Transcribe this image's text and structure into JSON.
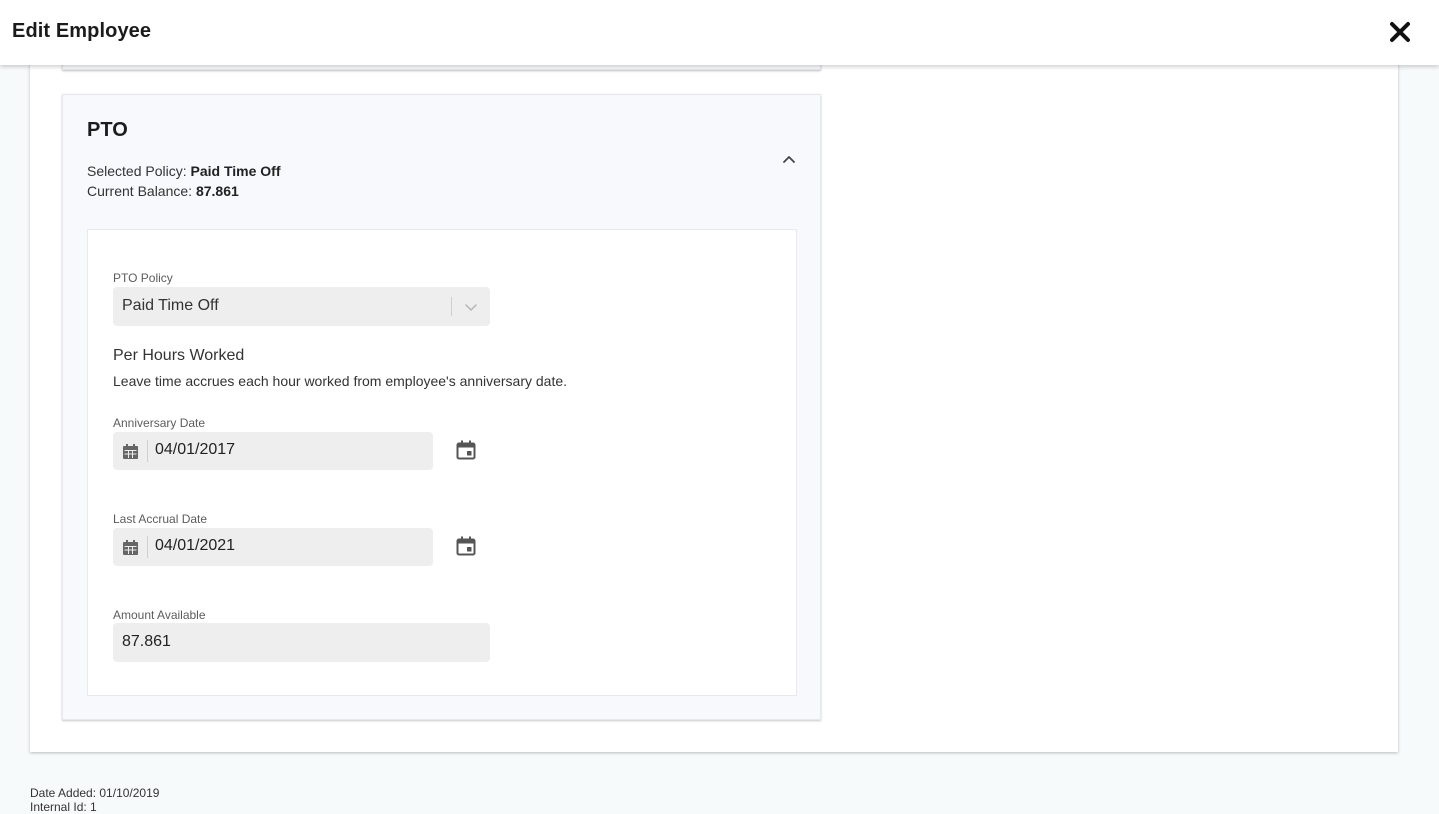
{
  "header": {
    "title": "Edit Employee",
    "close_icon": "close-icon"
  },
  "pto": {
    "title": "PTO",
    "selected_policy_label": "Selected Policy:",
    "selected_policy_value": "Paid Time Off",
    "current_balance_label": "Current Balance:",
    "current_balance_value": "87.861",
    "collapse_icon": "chevron-up-icon",
    "policy_field": {
      "label": "PTO Policy",
      "value": "Paid Time Off"
    },
    "accrual_method": {
      "title": "Per Hours Worked",
      "description": "Leave time accrues each hour worked from employee's anniversary date."
    },
    "anniversary_date": {
      "label": "Anniversary Date",
      "value": "04/01/2017"
    },
    "last_accrual_date": {
      "label": "Last Accrual Date",
      "value": "04/01/2021"
    },
    "amount_available": {
      "label": "Amount Available",
      "value": "87.861"
    }
  },
  "footer": {
    "date_added": "Date Added: 01/10/2019",
    "internal_id": "Internal Id: 1"
  },
  "colors": {
    "header_bg": "#ffffff",
    "page_bg": "#f7fafb",
    "input_bg": "#eeeeee",
    "icon_color": "#555555"
  }
}
